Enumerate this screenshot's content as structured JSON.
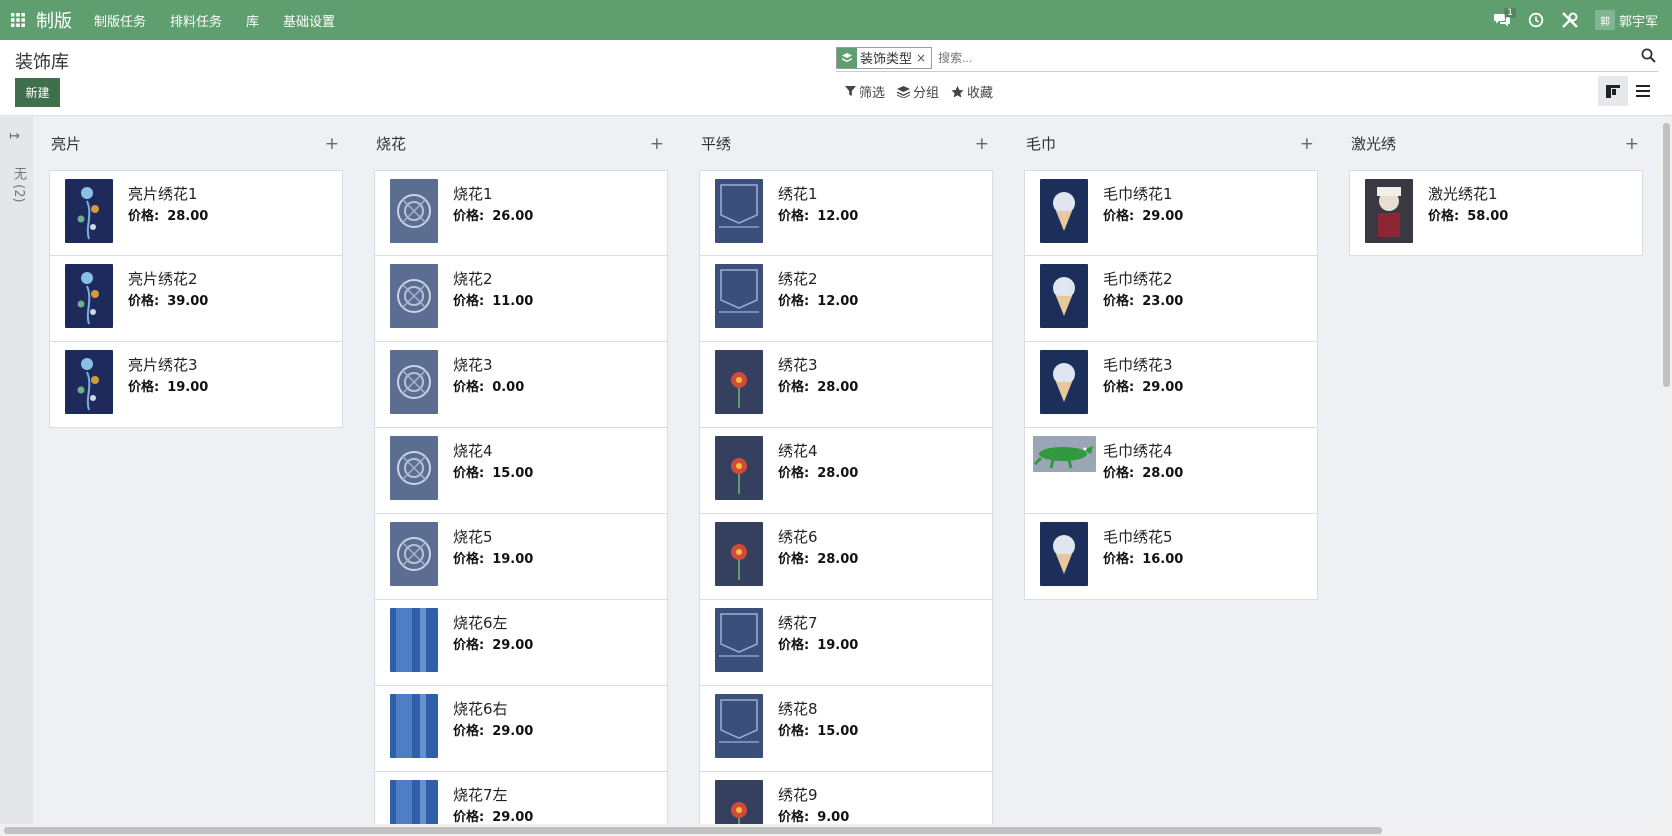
{
  "topbar": {
    "app_name": "制版",
    "menu": [
      "制版任务",
      "排料任务",
      "库",
      "基础设置"
    ],
    "chat_badge": "1",
    "user_initials": "郭",
    "user_name": "郭宇军",
    "bg_color": "#5f9e6e"
  },
  "control": {
    "title": "装饰库",
    "new_label": "新建",
    "facet_label": "装饰类型",
    "facet_close": "×",
    "search_placeholder": "搜索...",
    "filter_label": "筛选",
    "group_label": "分组",
    "favorite_label": "收藏"
  },
  "folded": {
    "arrow": "↦",
    "label": "无 (2)"
  },
  "columns": [
    {
      "title": "亮片",
      "add": "+",
      "cards": [
        {
          "name": "亮片绣花1",
          "price_label": "价格:",
          "price": "28.00",
          "thumb": "embroidery-floral"
        },
        {
          "name": "亮片绣花2",
          "price_label": "价格:",
          "price": "39.00",
          "thumb": "embroidery-floral"
        },
        {
          "name": "亮片绣花3",
          "price_label": "价格:",
          "price": "19.00",
          "thumb": "embroidery-floral"
        }
      ]
    },
    {
      "title": "烧花",
      "add": "+",
      "cards": [
        {
          "name": "烧花1",
          "price_label": "价格:",
          "price": "26.00",
          "thumb": "burnout-pattern"
        },
        {
          "name": "烧花2",
          "price_label": "价格:",
          "price": "11.00",
          "thumb": "burnout-pattern"
        },
        {
          "name": "烧花3",
          "price_label": "价格:",
          "price": "0.00",
          "thumb": "burnout-pattern"
        },
        {
          "name": "烧花4",
          "price_label": "价格:",
          "price": "15.00",
          "thumb": "burnout-pattern"
        },
        {
          "name": "烧花5",
          "price_label": "价格:",
          "price": "19.00",
          "thumb": "burnout-pattern"
        },
        {
          "name": "烧花6左",
          "price_label": "价格:",
          "price": "29.00",
          "thumb": "denim-wash"
        },
        {
          "name": "烧花6右",
          "price_label": "价格:",
          "price": "29.00",
          "thumb": "denim-wash"
        },
        {
          "name": "烧花7左",
          "price_label": "价格:",
          "price": "29.00",
          "thumb": "denim-wash"
        }
      ]
    },
    {
      "title": "平绣",
      "add": "+",
      "cards": [
        {
          "name": "绣花1",
          "price_label": "价格:",
          "price": "12.00",
          "thumb": "denim-pocket"
        },
        {
          "name": "绣花2",
          "price_label": "价格:",
          "price": "12.00",
          "thumb": "denim-pocket"
        },
        {
          "name": "绣花3",
          "price_label": "价格:",
          "price": "28.00",
          "thumb": "flat-embroidery"
        },
        {
          "name": "绣花4",
          "price_label": "价格:",
          "price": "28.00",
          "thumb": "flat-embroidery"
        },
        {
          "name": "绣花6",
          "price_label": "价格:",
          "price": "28.00",
          "thumb": "flat-embroidery"
        },
        {
          "name": "绣花7",
          "price_label": "价格:",
          "price": "19.00",
          "thumb": "denim-pocket"
        },
        {
          "name": "绣花8",
          "price_label": "价格:",
          "price": "15.00",
          "thumb": "denim-pocket"
        },
        {
          "name": "绣花9",
          "price_label": "价格:",
          "price": "9.00",
          "thumb": "flat-embroidery"
        }
      ]
    },
    {
      "title": "毛巾",
      "add": "+",
      "cards": [
        {
          "name": "毛巾绣花1",
          "price_label": "价格:",
          "price": "29.00",
          "thumb": "towel-patch"
        },
        {
          "name": "毛巾绣花2",
          "price_label": "价格:",
          "price": "23.00",
          "thumb": "towel-patch"
        },
        {
          "name": "毛巾绣花3",
          "price_label": "价格:",
          "price": "29.00",
          "thumb": "towel-patch"
        },
        {
          "name": "毛巾绣花4",
          "price_label": "价格:",
          "price": "28.00",
          "thumb": "crocodile-patch"
        },
        {
          "name": "毛巾绣花5",
          "price_label": "价格:",
          "price": "16.00",
          "thumb": "towel-patch"
        }
      ]
    },
    {
      "title": "激光绣",
      "add": "+",
      "cards": [
        {
          "name": "激光绣花1",
          "price_label": "价格:",
          "price": "58.00",
          "thumb": "laser-portrait"
        }
      ]
    }
  ]
}
